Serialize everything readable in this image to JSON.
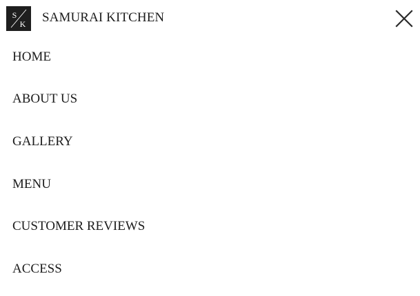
{
  "header": {
    "logo": {
      "letters": [
        "S",
        "K"
      ]
    },
    "site_title": "SAMURAI KITCHEN",
    "close_icon": "close-icon"
  },
  "nav": {
    "items": [
      {
        "label": "HOME"
      },
      {
        "label": "ABOUT US"
      },
      {
        "label": "GALLERY"
      },
      {
        "label": "MENU"
      },
      {
        "label": "CUSTOMER REVIEWS"
      },
      {
        "label": "ACCESS"
      }
    ]
  },
  "colors": {
    "background": "#ffffff",
    "text": "#1c1c1c",
    "logo_background": "#1e1e1e",
    "logo_foreground": "#ffffff"
  }
}
